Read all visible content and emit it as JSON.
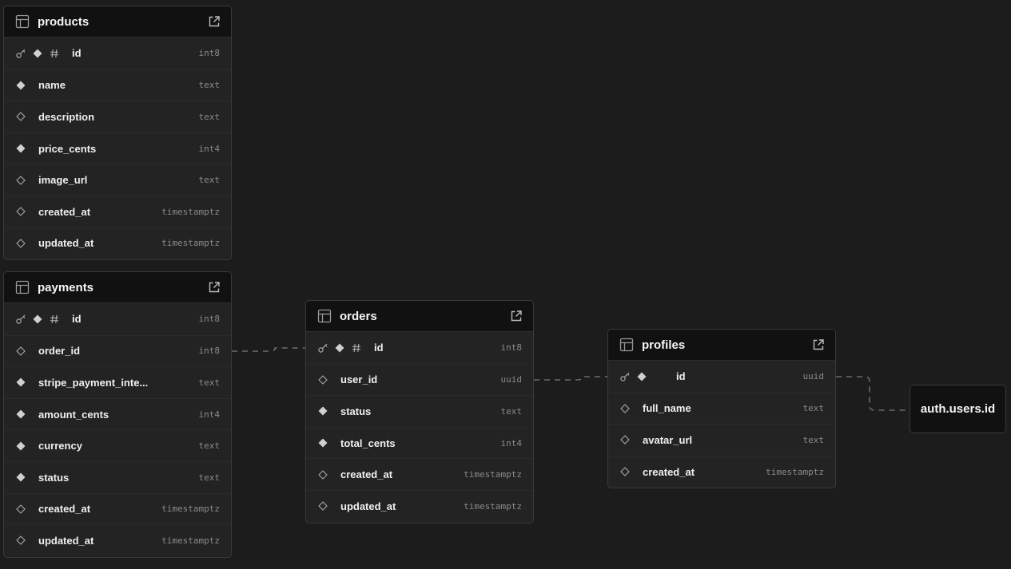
{
  "tables": {
    "products": {
      "name": "products",
      "columns": [
        {
          "name": "id",
          "type": "int8",
          "pk": true,
          "nullable": false
        },
        {
          "name": "name",
          "type": "text",
          "pk": false,
          "nullable": false
        },
        {
          "name": "description",
          "type": "text",
          "pk": false,
          "nullable": true
        },
        {
          "name": "price_cents",
          "type": "int4",
          "pk": false,
          "nullable": false
        },
        {
          "name": "image_url",
          "type": "text",
          "pk": false,
          "nullable": true
        },
        {
          "name": "created_at",
          "type": "timestamptz",
          "pk": false,
          "nullable": true
        },
        {
          "name": "updated_at",
          "type": "timestamptz",
          "pk": false,
          "nullable": true
        }
      ]
    },
    "payments": {
      "name": "payments",
      "columns": [
        {
          "name": "id",
          "type": "int8",
          "pk": true,
          "nullable": false
        },
        {
          "name": "order_id",
          "type": "int8",
          "pk": false,
          "nullable": true
        },
        {
          "name": "stripe_payment_inte...",
          "type": "text",
          "pk": false,
          "nullable": false
        },
        {
          "name": "amount_cents",
          "type": "int4",
          "pk": false,
          "nullable": false
        },
        {
          "name": "currency",
          "type": "text",
          "pk": false,
          "nullable": false
        },
        {
          "name": "status",
          "type": "text",
          "pk": false,
          "nullable": false
        },
        {
          "name": "created_at",
          "type": "timestamptz",
          "pk": false,
          "nullable": true
        },
        {
          "name": "updated_at",
          "type": "timestamptz",
          "pk": false,
          "nullable": true
        }
      ]
    },
    "orders": {
      "name": "orders",
      "columns": [
        {
          "name": "id",
          "type": "int8",
          "pk": true,
          "nullable": false
        },
        {
          "name": "user_id",
          "type": "uuid",
          "pk": false,
          "nullable": true
        },
        {
          "name": "status",
          "type": "text",
          "pk": false,
          "nullable": false
        },
        {
          "name": "total_cents",
          "type": "int4",
          "pk": false,
          "nullable": false
        },
        {
          "name": "created_at",
          "type": "timestamptz",
          "pk": false,
          "nullable": true
        },
        {
          "name": "updated_at",
          "type": "timestamptz",
          "pk": false,
          "nullable": true
        }
      ]
    },
    "profiles": {
      "name": "profiles",
      "columns": [
        {
          "name": "id",
          "type": "uuid",
          "pk": true,
          "identity": false,
          "nullable": false
        },
        {
          "name": "full_name",
          "type": "text",
          "pk": false,
          "nullable": true
        },
        {
          "name": "avatar_url",
          "type": "text",
          "pk": false,
          "nullable": true
        },
        {
          "name": "created_at",
          "type": "timestamptz",
          "pk": false,
          "nullable": true
        }
      ]
    }
  },
  "external_ref": {
    "label": "auth.users.id"
  },
  "colors": {
    "canvas": "#1c1c1c",
    "card": "#232323",
    "header": "#111111",
    "border": "#3a3a3a",
    "edge": "#6b6b6b",
    "marker": "#d0d0d0"
  },
  "icons": {
    "table": "table-grid-icon",
    "open": "external-link-icon",
    "primary_key": "key-icon",
    "not_null": "filled-diamond-icon",
    "nullable": "hollow-diamond-icon",
    "identity": "hash-icon"
  }
}
